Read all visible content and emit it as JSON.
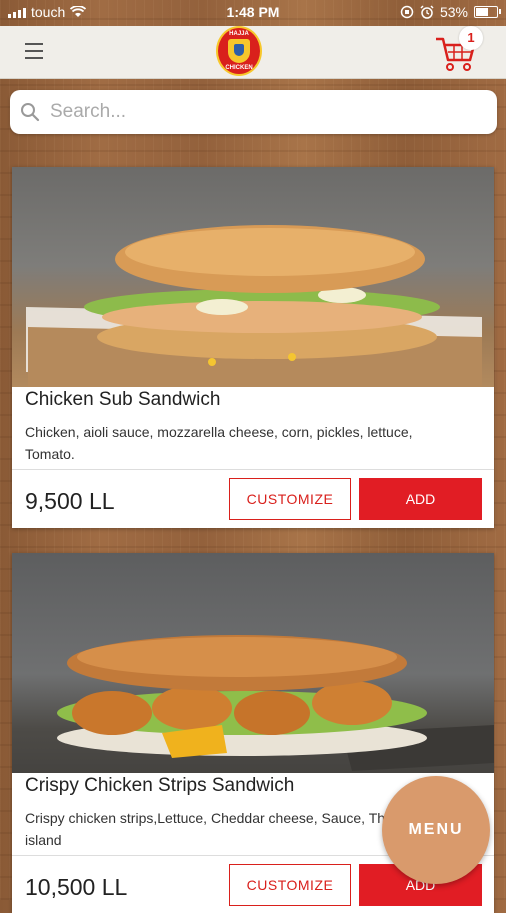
{
  "status_bar": {
    "carrier": "touch",
    "time": "1:48 PM",
    "battery_percent": "53%",
    "battery_level": 0.53
  },
  "header": {
    "logo_text_top": "HAJJA",
    "logo_text_bottom": "CHICKEN",
    "cart_count": "1",
    "icons": [
      "hamburger-icon",
      "cart-icon"
    ]
  },
  "search": {
    "placeholder": "Search..."
  },
  "products": [
    {
      "name": "Chicken Sub Sandwich",
      "description": "Chicken, aioli sauce, mozzarella cheese, corn, pickles, lettuce, Tomato.",
      "price": "9,500 LL",
      "customize_label": "CUSTOMIZE",
      "add_label": "ADD"
    },
    {
      "name": "Crispy Chicken Strips Sandwich",
      "description": "Crispy chicken strips,Lettuce, Cheddar cheese, Sauce, Thousand island",
      "price": "10,500 LL",
      "customize_label": "CUSTOMIZE",
      "add_label": "ADD"
    }
  ],
  "fab": {
    "label": "MENU"
  },
  "colors": {
    "accent": "#e11d24",
    "fab": "#d99a6c"
  }
}
